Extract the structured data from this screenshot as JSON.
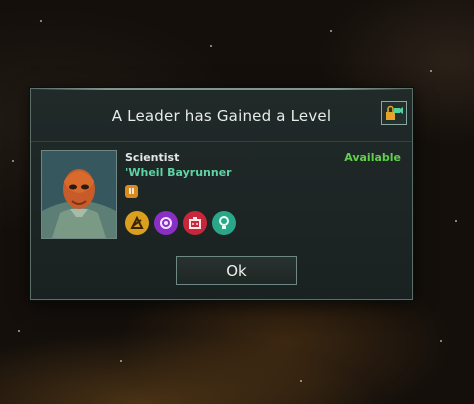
{
  "dialog": {
    "title": "A Leader has Gained a Level",
    "ok_label": "Ok"
  },
  "leader": {
    "role": "Scientist",
    "name": "'Wheil Bayrunner",
    "status": "Available",
    "level": "II",
    "traits": [
      {
        "icon": "research-beaker-icon",
        "color": "#d9a01e"
      },
      {
        "icon": "psionic-icon",
        "color": "#8a2fc4"
      },
      {
        "icon": "robot-icon",
        "color": "#c8263b"
      },
      {
        "icon": "lightbulb-icon",
        "color": "#2aa788"
      }
    ]
  },
  "colors": {
    "accent": "#5ed3a6",
    "status_available": "#62cf4c",
    "panel_bg": "#1d2625",
    "level_badge": "#d98b1e"
  }
}
